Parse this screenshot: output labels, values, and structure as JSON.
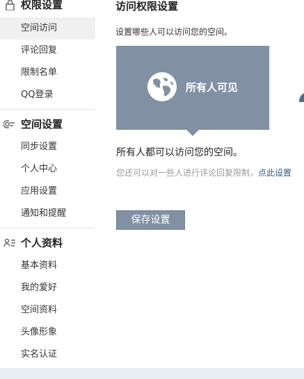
{
  "sidebar": {
    "sections": [
      {
        "icon": "lock-icon",
        "title": "权限设置",
        "items": [
          {
            "label": "空间访问",
            "active": true
          },
          {
            "label": "评论回复"
          },
          {
            "label": "限制名单"
          },
          {
            "label": "QQ登录"
          }
        ]
      },
      {
        "icon": "toggle-icon",
        "title": "空间设置",
        "items": [
          {
            "label": "同步设置"
          },
          {
            "label": "个人中心"
          },
          {
            "label": "应用设置"
          },
          {
            "label": "通知和提醒"
          }
        ]
      },
      {
        "icon": "profile-card-icon",
        "title": "个人资料",
        "items": [
          {
            "label": "基本资料"
          },
          {
            "label": "我的爱好"
          },
          {
            "label": "空间资料"
          },
          {
            "label": "头像形象"
          },
          {
            "label": "实名认证"
          }
        ]
      }
    ]
  },
  "main": {
    "title": "访问权限设置",
    "subtitle": "设置哪些人可以访问您的空间。",
    "options": [
      {
        "label": "所有人可见",
        "icon": "globe-icon",
        "selected": true
      }
    ],
    "description": "所有人都可以访问您的空间。",
    "note": "您还可以对一些人进行评论回复限制，",
    "note_link": "点此设置",
    "save_label": "保存设置"
  },
  "colors": {
    "selected_tile": "#8191a3",
    "active_item_bg": "#f0f0f0",
    "link": "#2a5a8c",
    "note_text": "#999999"
  }
}
